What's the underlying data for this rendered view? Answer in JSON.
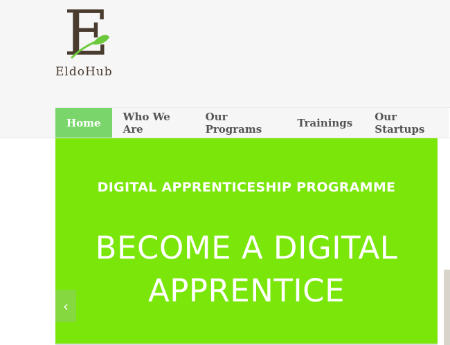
{
  "brand": {
    "logo_letter": "E",
    "logo_name": "EldoHub"
  },
  "nav": {
    "items": [
      {
        "label": "Home",
        "active": true
      },
      {
        "label": "Who We Are"
      },
      {
        "label": "Our Programs"
      },
      {
        "label": "Trainings"
      },
      {
        "label": "Our Startups"
      }
    ]
  },
  "slider": {
    "subtitle": "DIGITAL APPRENTICESHIP PROGRAMME",
    "title_line1": "BECOME A DIGITAL",
    "title_line2": "APPRENTICE",
    "prev_icon": "chevron-left-icon",
    "background_color": "#7be60a"
  },
  "colors": {
    "accent": "#7ad66b",
    "brand_brown": "#4a3b2f",
    "leaf_green": "#6cc93b"
  }
}
